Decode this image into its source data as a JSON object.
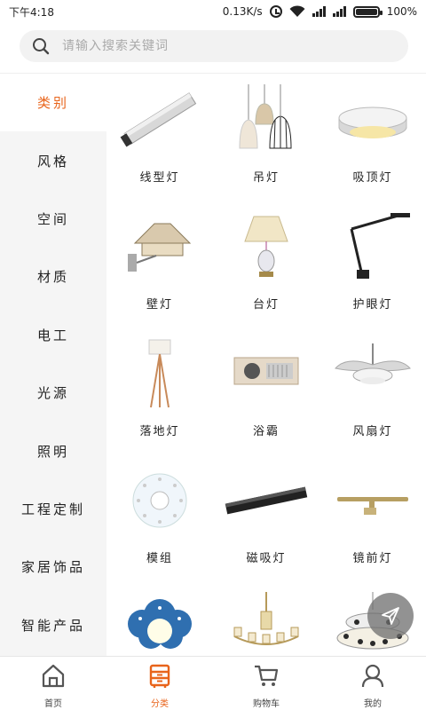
{
  "status_bar": {
    "time": "下午4:18",
    "speed": "0.13K/s",
    "battery": "100%",
    "battery_level": 1.0
  },
  "search": {
    "placeholder": "请输入搜索关键词"
  },
  "sidebar": {
    "items": [
      {
        "label": "类别",
        "active": true
      },
      {
        "label": "风格",
        "active": false
      },
      {
        "label": "空间",
        "active": false
      },
      {
        "label": "材质",
        "active": false
      },
      {
        "label": "电工",
        "active": false
      },
      {
        "label": "光源",
        "active": false
      },
      {
        "label": "照明",
        "active": false
      },
      {
        "label": "工程定制",
        "active": false
      },
      {
        "label": "家居饰品",
        "active": false
      },
      {
        "label": "智能产品",
        "active": false
      }
    ]
  },
  "grid": {
    "items": [
      {
        "label": "线型灯",
        "icon": "linear-light-icon"
      },
      {
        "label": "吊灯",
        "icon": "pendant-light-icon"
      },
      {
        "label": "吸顶灯",
        "icon": "ceiling-light-icon"
      },
      {
        "label": "壁灯",
        "icon": "wall-light-icon"
      },
      {
        "label": "台灯",
        "icon": "table-lamp-icon"
      },
      {
        "label": "护眼灯",
        "icon": "desk-lamp-icon"
      },
      {
        "label": "落地灯",
        "icon": "floor-lamp-icon"
      },
      {
        "label": "浴霸",
        "icon": "bath-heater-icon"
      },
      {
        "label": "风扇灯",
        "icon": "fan-light-icon"
      },
      {
        "label": "模组",
        "icon": "led-module-icon"
      },
      {
        "label": "磁吸灯",
        "icon": "magnetic-track-icon"
      },
      {
        "label": "镜前灯",
        "icon": "mirror-light-icon"
      },
      {
        "label": "",
        "icon": "kids-light-icon"
      },
      {
        "label": "",
        "icon": "chandelier-icon"
      },
      {
        "label": "",
        "icon": "crystal-chandelier-icon"
      }
    ]
  },
  "tabbar": {
    "items": [
      {
        "label": "首页",
        "icon": "home-icon",
        "active": false
      },
      {
        "label": "分类",
        "icon": "category-icon",
        "active": true
      },
      {
        "label": "购物车",
        "icon": "cart-icon",
        "active": false
      },
      {
        "label": "我的",
        "icon": "user-icon",
        "active": false
      }
    ]
  },
  "colors": {
    "accent": "#e8641b",
    "sidebar_bg": "#f5f5f5",
    "search_bg": "#f2f2f2"
  }
}
